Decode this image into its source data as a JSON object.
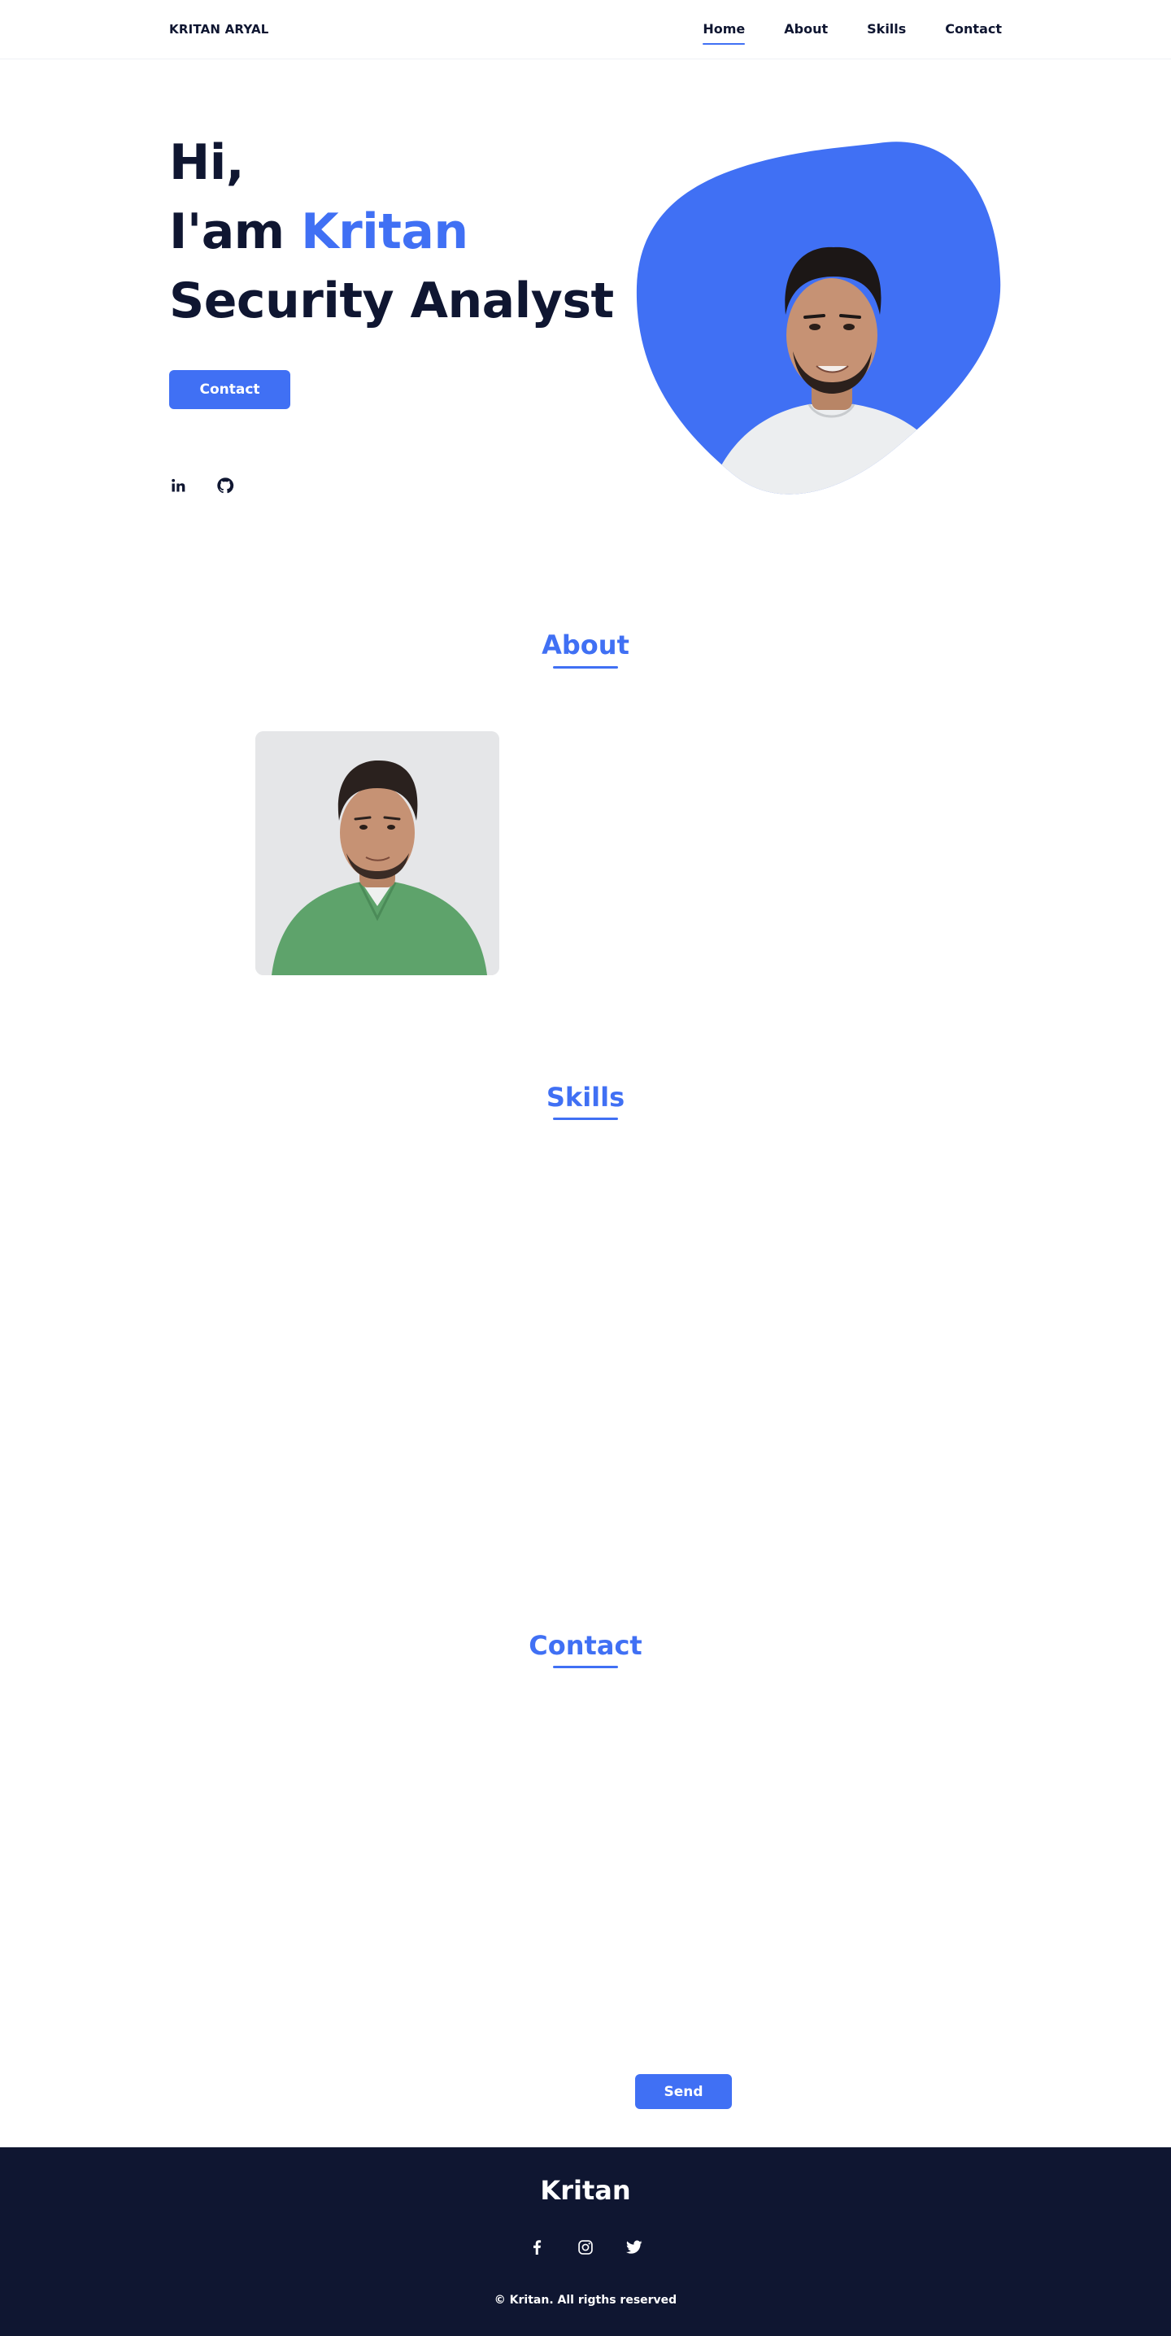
{
  "header": {
    "logo": "KRITAN ARYAL",
    "nav": [
      {
        "label": "Home",
        "active": true
      },
      {
        "label": "About",
        "active": false
      },
      {
        "label": "Skills",
        "active": false
      },
      {
        "label": "Contact",
        "active": false
      }
    ]
  },
  "hero": {
    "greeting": "Hi,",
    "intro_prefix": "I'am ",
    "name": "Kritan",
    "role": "Security Analyst",
    "contact_button": "Contact",
    "social_icons": [
      "linkedin-icon",
      "github-icon"
    ],
    "blob_color": "#4070f4"
  },
  "about": {
    "title": "About"
  },
  "skills": {
    "title": "Skills"
  },
  "contact": {
    "title": "Contact",
    "send_button": "Send"
  },
  "footer": {
    "title": "Kritan",
    "social_icons": [
      "facebook-icon",
      "instagram-icon",
      "twitter-icon"
    ],
    "copyright": "© Kritan. All rigths reserved"
  },
  "colors": {
    "accent": "#4070f4",
    "dark": "#0f1631"
  }
}
